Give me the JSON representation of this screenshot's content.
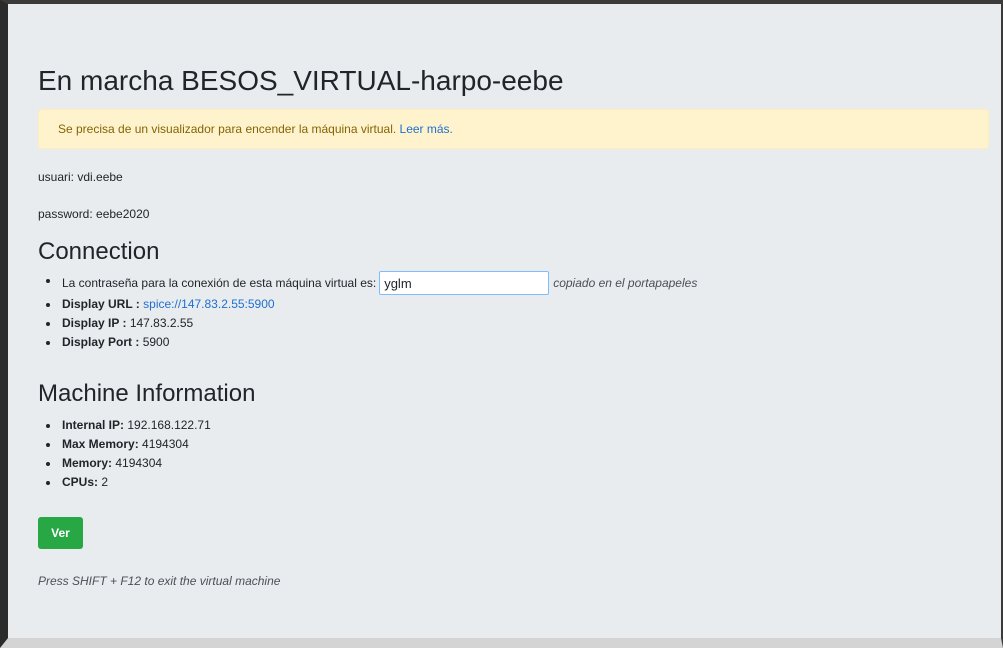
{
  "page": {
    "title": "En marcha BESOS_VIRTUAL-harpo-eebe"
  },
  "alert": {
    "text": "Se precisa de un visualizador para encender la máquina virtual. ",
    "link": "Leer más."
  },
  "credentials": {
    "user_line": "usuari: vdi.eebe",
    "password_line": "password: eebe2020"
  },
  "connection": {
    "heading": "Connection",
    "password_label": "La contraseña para la conexión de esta máquina virtual es:",
    "password_value": "yglm",
    "copied_note": "copiado en el portapapeles",
    "display_url_label": "Display URL :",
    "display_url_value": "spice://147.83.2.55:5900",
    "display_ip_label": "Display IP :",
    "display_ip_value": "147.83.2.55",
    "display_port_label": "Display Port :",
    "display_port_value": "5900"
  },
  "machine": {
    "heading": "Machine Information",
    "internal_ip_label": "Internal IP:",
    "internal_ip_value": "192.168.122.71",
    "max_memory_label": "Max Memory:",
    "max_memory_value": "4194304",
    "memory_label": "Memory:",
    "memory_value": "4194304",
    "cpus_label": "CPUs:",
    "cpus_value": "2"
  },
  "actions": {
    "view_button": "Ver"
  },
  "footer": {
    "hint": "Press SHIFT + F12 to exit the virtual machine"
  },
  "colors": {
    "background": "#e9ecef",
    "alert_bg": "#fff3cd",
    "link": "#1f6fd1",
    "button": "#28a745"
  }
}
